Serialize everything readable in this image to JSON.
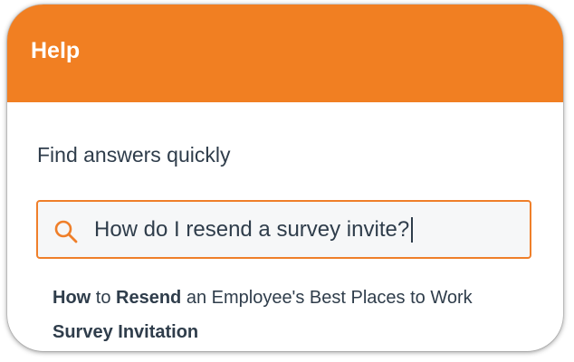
{
  "header": {
    "title": "Help"
  },
  "main": {
    "subtitle": "Find answers quickly"
  },
  "search": {
    "value": "How do I resend a survey invite?",
    "icon": "search-icon"
  },
  "results": [
    {
      "segments": [
        {
          "text": "How",
          "bold": true
        },
        {
          "text": " to ",
          "bold": false
        },
        {
          "text": "Resend",
          "bold": true
        },
        {
          "text": " an Employee's Best Places to Work ",
          "bold": false
        },
        {
          "text": "Survey Invitation",
          "bold": true
        }
      ]
    }
  ],
  "colors": {
    "accent": "#f17f22",
    "text": "#2f3d4b",
    "input_border": "#ef7f2a",
    "input_bg": "#f6f7f8"
  }
}
